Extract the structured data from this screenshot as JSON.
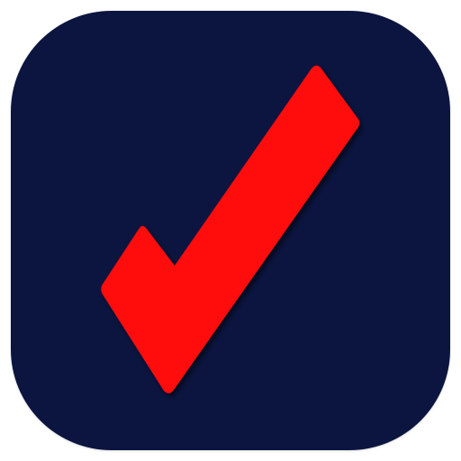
{
  "icon": {
    "name": "checkmark-app-icon",
    "glyph": "checkmark-icon",
    "background_color": "#0b1540",
    "check_color": "#ff0a0a",
    "check_shadow_color": "#000000"
  }
}
